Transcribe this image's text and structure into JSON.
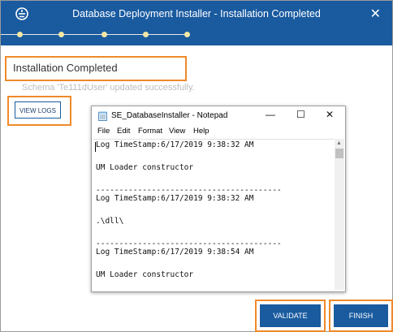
{
  "window": {
    "title": "Database Deployment Installer - Installation Completed",
    "close_glyph": "✕",
    "app_icon": "installer-logo-icon"
  },
  "progress": {
    "steps": 5,
    "completed_steps": 5,
    "dot_color": "#f3e7a4"
  },
  "status": {
    "title": "Installation Completed",
    "message": "Schema 'Te111dUser' updated successfully."
  },
  "buttons": {
    "view_logs": "VIEW LOGS",
    "validate": "VALIDATE",
    "finish": "FINISH"
  },
  "notepad": {
    "title": "SE_DatabaseInstaller - Notepad",
    "minimize_glyph": "—",
    "maximize_glyph": "☐",
    "close_glyph": "✕",
    "menu": [
      "File",
      "Edit",
      "Format",
      "View",
      "Help"
    ],
    "lines": [
      "Log TimeStamp:6/17/2019 9:38:32 AM",
      "",
      "UM Loader constructor",
      "",
      "----------------------------------------",
      "Log TimeStamp:6/17/2019 9:38:32 AM",
      "",
      ".\\dll\\",
      "",
      "----------------------------------------",
      "Log TimeStamp:6/17/2019 9:38:54 AM",
      "",
      "UM Loader constructor"
    ],
    "scroll_up_glyph": "▲"
  },
  "colors": {
    "primary": "#1a5ba0",
    "highlight_border": "#ef8a2a",
    "muted_text": "#bdbdbd"
  }
}
